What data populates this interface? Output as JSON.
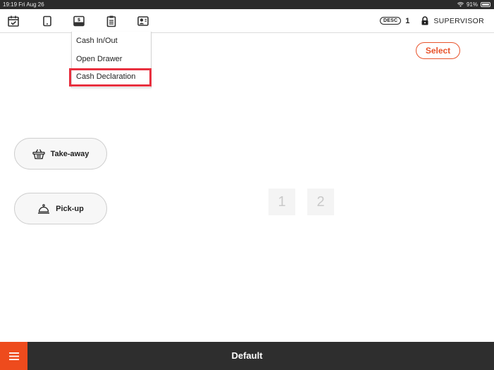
{
  "status_bar": {
    "time": "19:19  Fri Aug 26",
    "battery": "91%"
  },
  "toolbar": {
    "icons": [
      "calendar-icon",
      "tablet-icon",
      "cash-drawer-icon",
      "clipboard-icon",
      "staff-icon"
    ],
    "desc_label": "DESC",
    "desc_count": "1",
    "user_label": "SUPERVISOR"
  },
  "dropdown": {
    "items": [
      "Cash In/Out",
      "Open Drawer",
      "Cash Declaration"
    ],
    "highlighted_item": "Cash Declaration"
  },
  "select_button": {
    "label": "Select"
  },
  "order_types": [
    {
      "label": "Take-away",
      "icon": "basket-icon"
    },
    {
      "label": "Pick-up",
      "icon": "cloche-icon"
    }
  ],
  "tables": [
    "1",
    "2"
  ],
  "bottom_bar": {
    "title": "Default",
    "menu_icon": "hamburger-icon"
  },
  "colors": {
    "accent": "#ee4b1d",
    "highlight": "#e8303f",
    "bottom_bar": "#2e2e2e"
  }
}
